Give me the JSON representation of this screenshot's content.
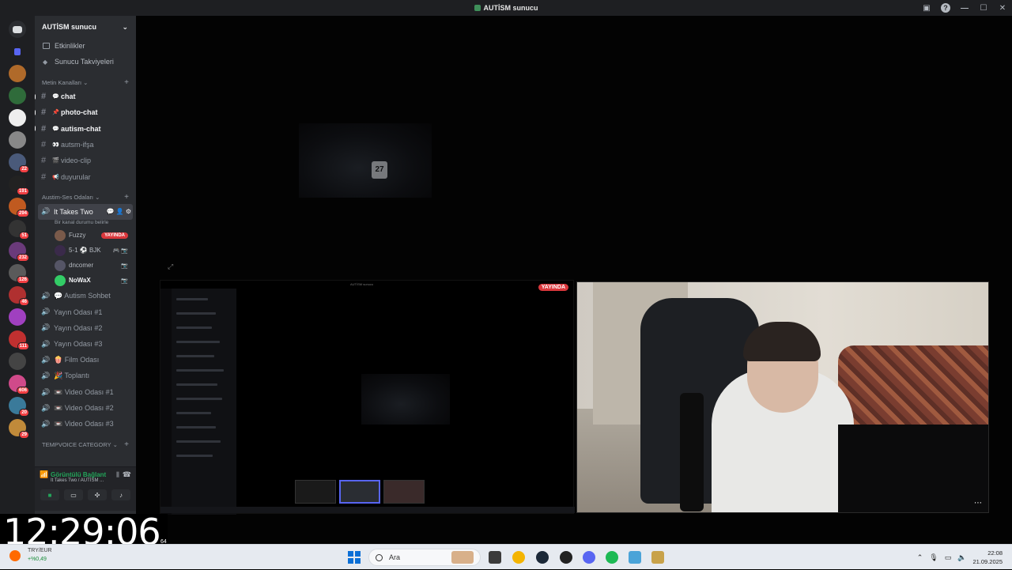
{
  "window": {
    "title": "AUTİSM sunucu"
  },
  "guilds": {
    "badges": [
      "22",
      "191",
      "294",
      "51",
      "232",
      "126",
      "46",
      "111",
      "606",
      "20",
      "29"
    ]
  },
  "server": {
    "name": "AUTİSM sunucu",
    "top_items": [
      {
        "label": "Etkinlikler"
      },
      {
        "label": "Sunucu Takviyeleri"
      }
    ],
    "text_category": "Metin Kanalları",
    "text_channels": [
      {
        "label": "chat",
        "emoji": "💬",
        "unread": true
      },
      {
        "label": "photo-chat",
        "emoji": "📌",
        "unread": true
      },
      {
        "label": "autism-chat",
        "emoji": "💬",
        "unread": true
      },
      {
        "label": "autsm-ifşa",
        "emoji": "👀",
        "unread": false
      },
      {
        "label": "video-clip",
        "emoji": "🎬",
        "unread": false
      },
      {
        "label": "duyurular",
        "emoji": "📢",
        "unread": false
      }
    ],
    "voice_category": "Austim-Ses Odaları",
    "active_voice": {
      "name": "It Takes Two",
      "status_hint": "Bir kanal durumu belirle",
      "members": [
        {
          "name": "Fuzzy",
          "badge": "YAYINDA",
          "color": "#7a5a4a"
        },
        {
          "name": "5-1 ⚽ BJK",
          "tail": "🎮 📷",
          "color": "#3a2a4a"
        },
        {
          "name": "dncomer",
          "tail": "📷",
          "color": "#556"
        },
        {
          "name": "NoWaX",
          "tail": "📷",
          "color": "#3c6"
        }
      ]
    },
    "voice_channels": [
      {
        "label": "💬 Autism Sohbet"
      },
      {
        "label": "Yayın Odası #1"
      },
      {
        "label": "Yayın Odası #2"
      },
      {
        "label": "Yayın Odası #3"
      },
      {
        "label": "🍿 Film Odası"
      },
      {
        "label": "🎉 Toplantı"
      },
      {
        "label": "📼 Video Odası #1"
      },
      {
        "label": "📼 Video Odası #2"
      },
      {
        "label": "📼 Video Odası #3"
      }
    ],
    "temp_category": "TEMPVOICE CATEGORY"
  },
  "voice_panel": {
    "title": "Görüntülü Bağlant",
    "subtitle": "It Takes Two / AUTİSM ..."
  },
  "stage": {
    "live_badge": "YAYINDA",
    "mini_title": "AUTİSM sunucu",
    "jersey_number": "27"
  },
  "overlay_clock": {
    "time": "12:29:06",
    "tail": "64"
  },
  "ticker": {
    "symbol": "TRY/EUR",
    "change": "+%0,49"
  },
  "taskbar": {
    "search_placeholder": "Ara",
    "time": "22:08",
    "date": "21.09.2025"
  }
}
